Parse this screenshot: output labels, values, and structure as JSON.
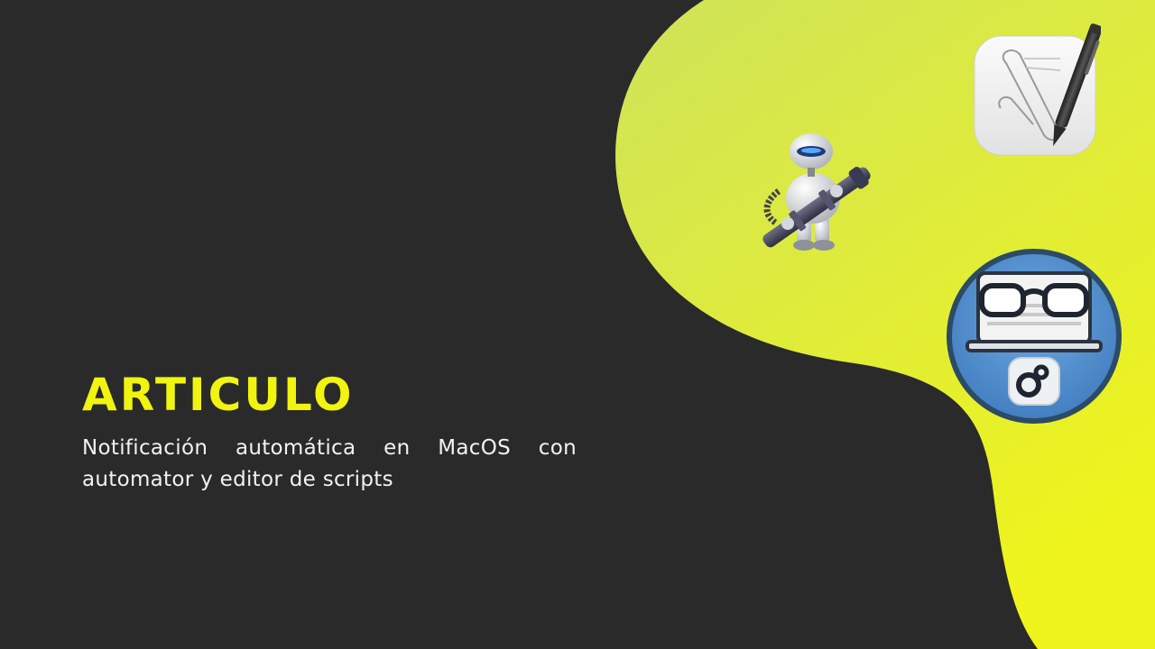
{
  "heading": "ARTICULO",
  "subtitle": "Notificación automática en MacOS con automator y editor de scripts",
  "colors": {
    "background": "#2a2a2a",
    "accent": "#f0f40f",
    "gradient_start": "#cfe35a",
    "gradient_end": "#eef41c"
  },
  "icons": {
    "automator": "automator-robot-icon",
    "script_editor": "script-editor-icon",
    "reader": "glasses-laptop-link-icon"
  }
}
